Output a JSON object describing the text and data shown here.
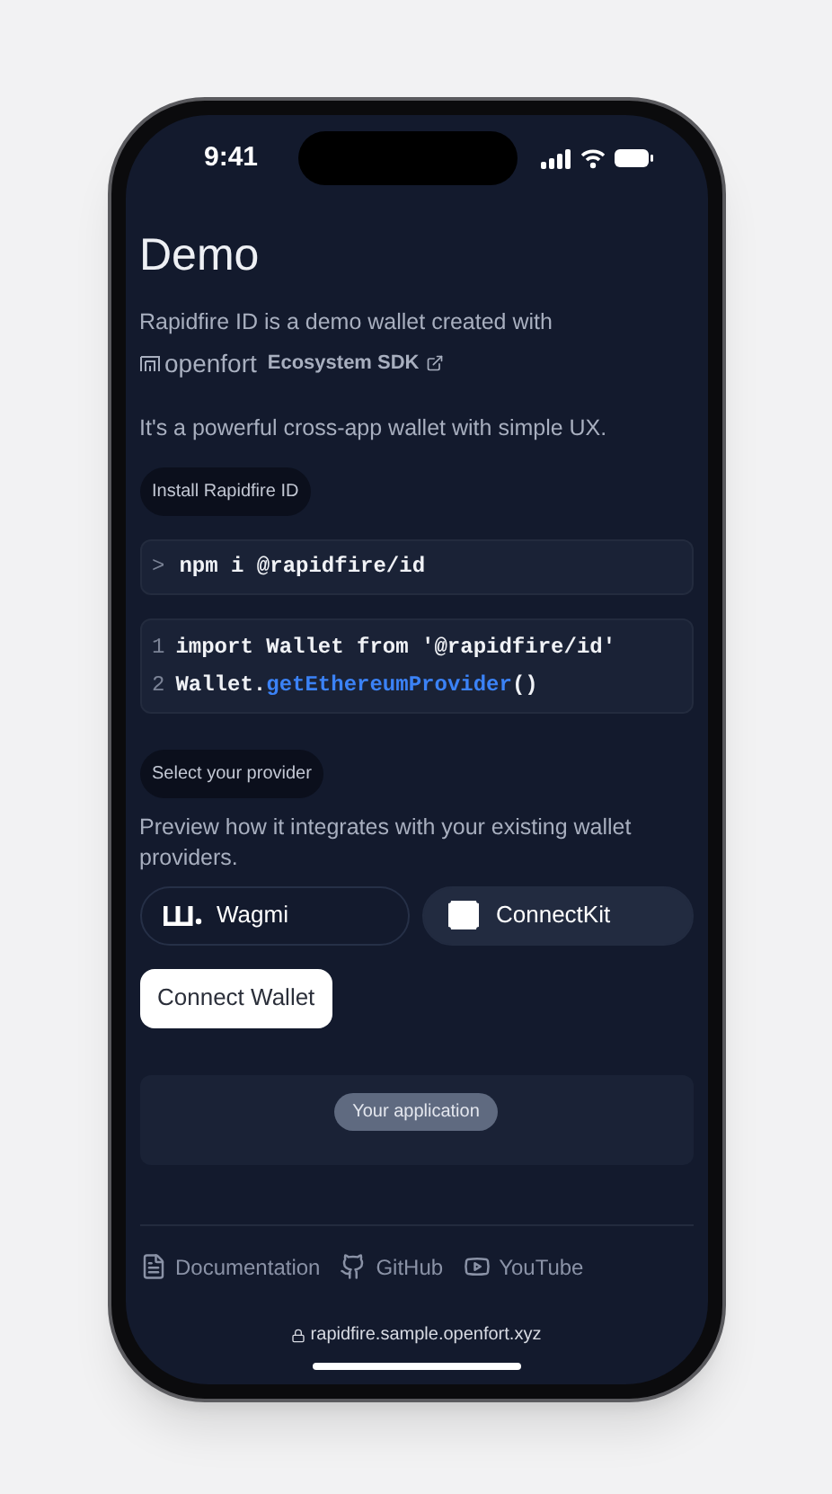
{
  "status_bar": {
    "time": "9:41"
  },
  "title": "Demo",
  "intro": {
    "text": "Rapidfire ID is a demo wallet created with",
    "brand": "openfort",
    "link": "Ecosystem SDK"
  },
  "tagline": "It's a powerful cross-app wallet with simple UX.",
  "install": {
    "badge": "Install Rapidfire ID",
    "prompt": ">",
    "command": "npm i @rapidfire/id"
  },
  "code": [
    {
      "number": "1",
      "parts": [
        {
          "text": "import Wallet from '@rapidfire/id'",
          "kind": "plain"
        }
      ]
    },
    {
      "number": "2",
      "parts": [
        {
          "text": "Wallet.",
          "kind": "plain"
        },
        {
          "text": "getEthereumProvider",
          "kind": "method"
        },
        {
          "text": "()",
          "kind": "plain"
        }
      ]
    }
  ],
  "provider_section": {
    "badge": "Select your provider",
    "description": "Preview how it integrates with your existing wallet providers."
  },
  "providers": [
    {
      "label": "Wagmi",
      "kind": "wagmi",
      "selected": false
    },
    {
      "label": "ConnectKit",
      "kind": "connectkit",
      "selected": true
    }
  ],
  "connect_button": "Connect Wallet",
  "app_preview": {
    "badge": "Your application"
  },
  "footer_links": [
    {
      "label": "Documentation",
      "kind": "doc"
    },
    {
      "label": "GitHub",
      "kind": "github"
    },
    {
      "label": "YouTube",
      "kind": "youtube"
    }
  ],
  "url_bar": {
    "url": "rapidfire.sample.openfort.xyz"
  }
}
